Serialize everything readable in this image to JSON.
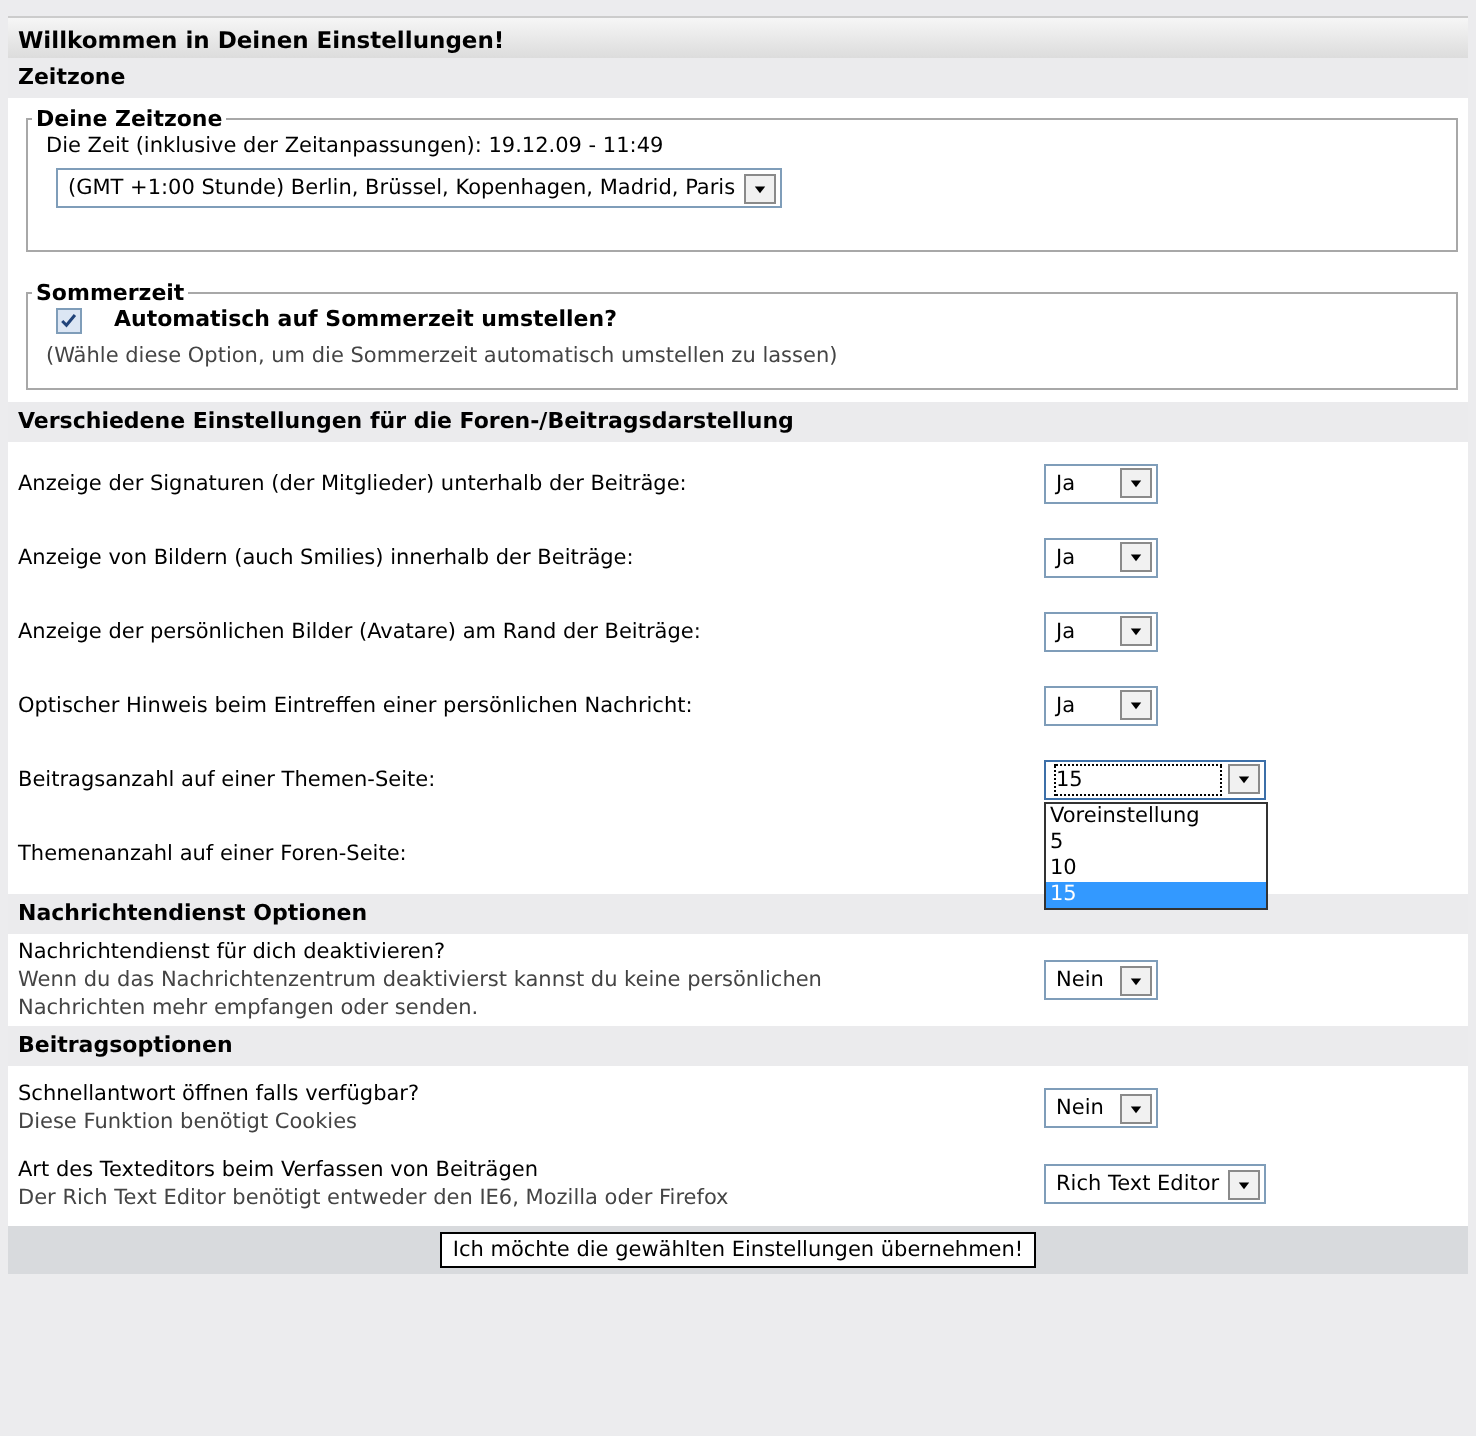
{
  "title": "Willkommen in Deinen Einstellungen!",
  "sections": [
    {
      "kind": "fieldsets",
      "heading": "Zeitzone",
      "fieldsets": [
        {
          "kind": "select",
          "legend": "Deine Zeitzone",
          "text": "Die Zeit (inklusive der Zeitanpassungen): 19.12.09 - 11:49",
          "value": "(GMT +1:00 Stunde) Berlin, Brüssel, Kopenhagen, Madrid, Paris"
        },
        {
          "kind": "checkbox",
          "legend": "Sommerzeit",
          "label": "Automatisch auf Sommerzeit umstellen?",
          "checked": true,
          "hint": "(Wähle diese Option, um die Sommerzeit automatisch umstellen zu lassen)"
        }
      ]
    },
    {
      "kind": "rows",
      "heading": "Verschiedene Einstellungen für die Foren-/Beitragsdarstellung",
      "rows": [
        {
          "label": "Anzeige der Signaturen (der Mitglieder) unterhalb der Beiträge:",
          "value": "Ja"
        },
        {
          "label": "Anzeige von Bildern (auch Smilies) innerhalb der Beiträge:",
          "value": "Ja"
        },
        {
          "label": "Anzeige der persönlichen Bilder (Avatare) am Rand der Beiträge:",
          "value": "Ja"
        },
        {
          "label": "Optischer Hinweis beim Eintreffen einer persönlichen Nachricht:",
          "value": "Ja"
        },
        {
          "label": "Beitragsanzahl auf einer Themen-Seite:",
          "value": "15",
          "expanded": true,
          "options": [
            {
              "label": "Voreinstellung",
              "selected": false
            },
            {
              "label": "5",
              "selected": false
            },
            {
              "label": "10",
              "selected": false
            },
            {
              "label": "15",
              "selected": true
            }
          ]
        },
        {
          "label": "Themenanzahl auf einer Foren-Seite:"
        }
      ]
    },
    {
      "kind": "rows",
      "heading": "Nachrichtendienst Optionen",
      "rows": [
        {
          "label": "Nachrichtendienst für dich deaktivieren?",
          "hint": "Wenn du das Nachrichtenzentrum deaktivierst kannst du keine persönlichen Nachrichten mehr empfangen oder senden.",
          "value": "Nein"
        }
      ]
    },
    {
      "kind": "rows",
      "heading": "Beitragsoptionen",
      "rows": [
        {
          "label": "Schnellantwort öffnen falls verfügbar?",
          "hint": "Diese Funktion benötigt Cookies",
          "value": "Nein"
        },
        {
          "label": "Art des Texteditors beim Verfassen von Beiträgen",
          "hint": "Der Rich Text Editor benötigt entweder den IE6, Mozilla oder Firefox",
          "value": "Rich Text Editor"
        }
      ]
    }
  ],
  "submit": "Ich möchte die gewählten Einstellungen übernehmen!"
}
